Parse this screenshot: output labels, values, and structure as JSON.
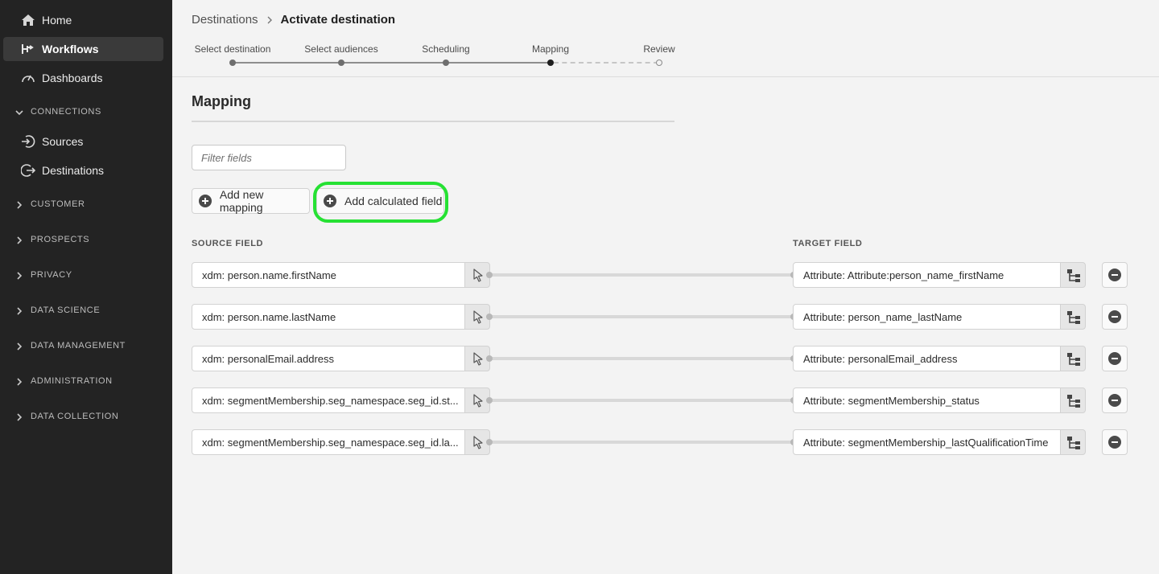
{
  "sidebar": {
    "home": "Home",
    "workflows": "Workflows",
    "dashboards": "Dashboards",
    "connections": "CONNECTIONS",
    "sources": "Sources",
    "destinations": "Destinations",
    "customer": "CUSTOMER",
    "prospects": "PROSPECTS",
    "privacy": "PRIVACY",
    "data_science": "DATA SCIENCE",
    "data_management": "DATA MANAGEMENT",
    "administration": "ADMINISTRATION",
    "data_collection": "DATA COLLECTION"
  },
  "breadcrumb": {
    "parent": "Destinations",
    "current": "Activate destination"
  },
  "steps": [
    "Select destination",
    "Select audiences",
    "Scheduling",
    "Mapping",
    "Review"
  ],
  "current_step": "Mapping",
  "mapping": {
    "title": "Mapping",
    "filter_placeholder": "Filter fields",
    "add_mapping": "Add new mapping",
    "add_calculated": "Add calculated field",
    "source_header": "SOURCE FIELD",
    "target_header": "TARGET FIELD",
    "rows": [
      {
        "source": "xdm: person.name.firstName",
        "target": "Attribute: Attribute:person_name_firstName"
      },
      {
        "source": "xdm: person.name.lastName",
        "target": "Attribute: person_name_lastName"
      },
      {
        "source": "xdm: personalEmail.address",
        "target": "Attribute: personalEmail_address"
      },
      {
        "source": "xdm: segmentMembership.seg_namespace.seg_id.st...",
        "target": "Attribute: segmentMembership_status"
      },
      {
        "source": "xdm: segmentMembership.seg_namespace.seg_id.la...",
        "target": "Attribute: segmentMembership_lastQualificationTime"
      }
    ]
  },
  "colors": {
    "sidebar_bg": "#232323",
    "highlight": "#26e133"
  }
}
